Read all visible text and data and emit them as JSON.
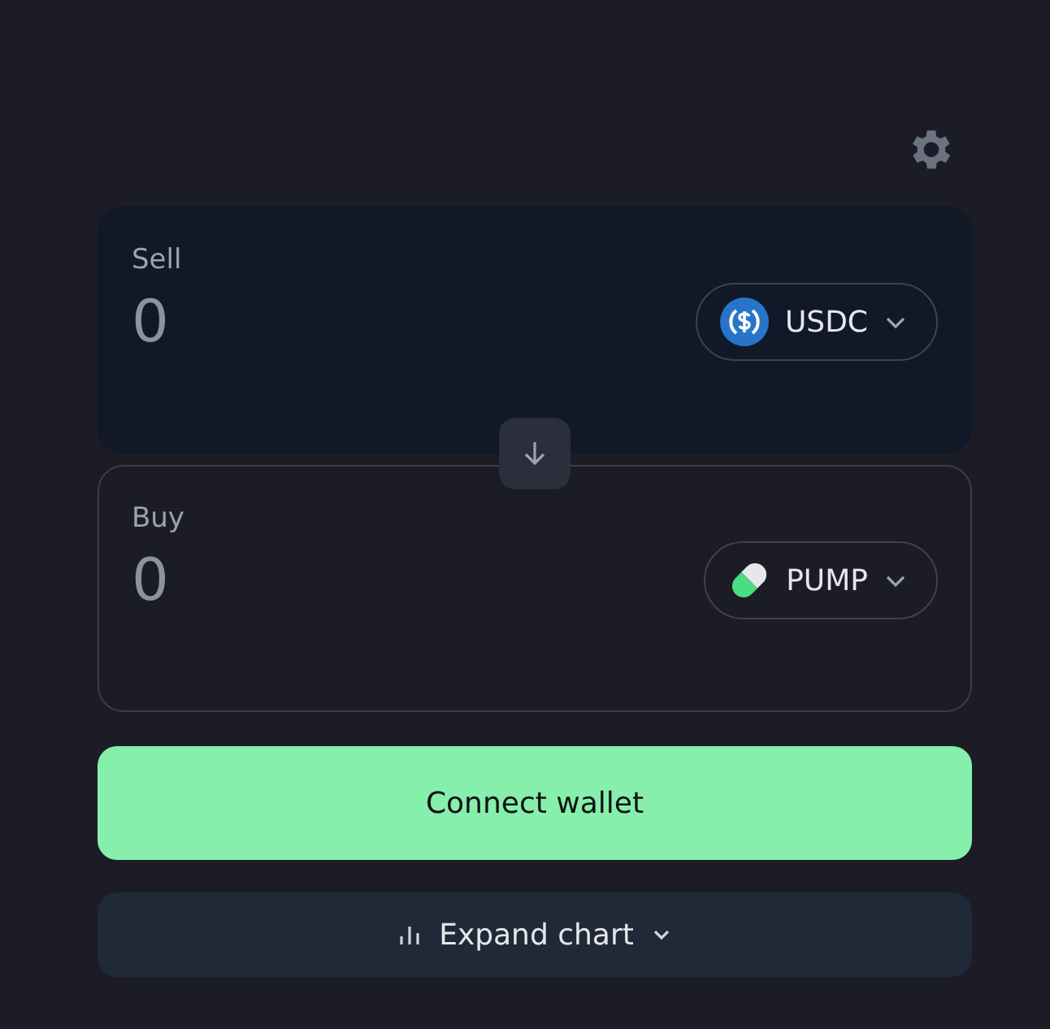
{
  "panels": [
    {
      "label": "Sell",
      "amount": {
        "placeholder": "0"
      },
      "token": {
        "symbol": "USDC",
        "kind": "coin"
      },
      "selected": true
    },
    {
      "label": "Buy",
      "amount": {
        "placeholder": "0"
      },
      "token": {
        "symbol": "PUMP",
        "kind": "pill"
      },
      "selected": false
    }
  ],
  "primary_button": "Connect wallet",
  "chart_toggle": {
    "label": "Expand chart",
    "expanded": false
  }
}
